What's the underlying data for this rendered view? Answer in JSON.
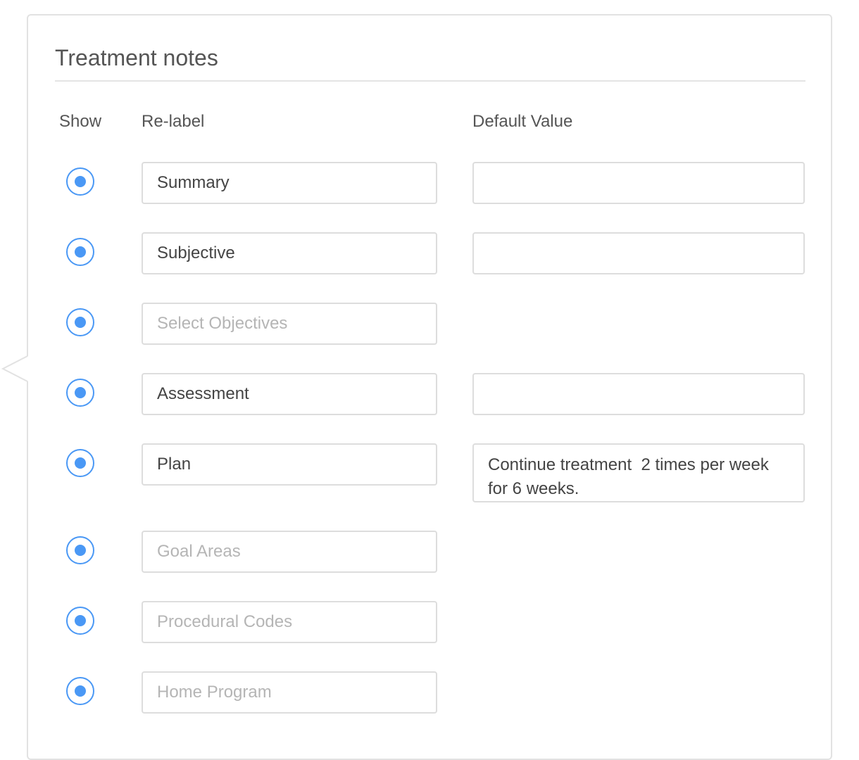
{
  "section": {
    "title": "Treatment notes"
  },
  "columns": {
    "show": "Show",
    "relabel": "Re-label",
    "default_value": "Default Value"
  },
  "rows": [
    {
      "label_value": "Summary",
      "label_placeholder": "",
      "show": true,
      "default_value": ""
    },
    {
      "label_value": "Subjective",
      "label_placeholder": "",
      "show": true,
      "default_value": ""
    },
    {
      "label_value": "",
      "label_placeholder": "Select Objectives",
      "show": true
    },
    {
      "label_value": "Assessment",
      "label_placeholder": "",
      "show": true,
      "default_value": ""
    },
    {
      "label_value": "Plan",
      "label_placeholder": "",
      "show": true,
      "default_value": "Continue treatment  2 times per week for 6 weeks."
    },
    {
      "label_value": "",
      "label_placeholder": "Goal Areas",
      "show": true
    },
    {
      "label_value": "",
      "label_placeholder": "Procedural Codes",
      "show": true
    },
    {
      "label_value": "",
      "label_placeholder": "Home Program",
      "show": true
    }
  ],
  "colors": {
    "accent": "#4a98f5",
    "border": "#dddddd",
    "text": "#555555",
    "placeholder": "#b5b5b5"
  }
}
